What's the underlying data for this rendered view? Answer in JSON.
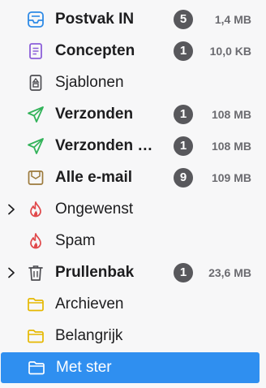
{
  "folders": [
    {
      "label": "Postvak IN",
      "badge": "5",
      "size": "1,4 MB",
      "icon": "inbox-icon"
    },
    {
      "label": "Concepten",
      "badge": "1",
      "size": "10,0 KB",
      "icon": "drafts-icon"
    },
    {
      "label": "Sjablonen",
      "icon": "templates-icon"
    },
    {
      "label": "Verzonden",
      "badge": "1",
      "size": "108 MB",
      "icon": "sent-icon"
    },
    {
      "label": "Verzonden …",
      "badge": "1",
      "size": "108 MB",
      "icon": "sent-icon"
    },
    {
      "label": "Alle e-mail",
      "badge": "9",
      "size": "109 MB",
      "icon": "archive-box-icon"
    },
    {
      "label": "Ongewenst",
      "icon": "junk-flame-icon",
      "twisty": "chevron-right-icon"
    },
    {
      "label": "Spam",
      "icon": "junk-flame-icon"
    },
    {
      "label": "Prullenbak",
      "badge": "1",
      "size": "23,6 MB",
      "icon": "trash-icon",
      "twisty": "chevron-right-icon"
    },
    {
      "label": "Archieven",
      "icon": "folder-icon"
    },
    {
      "label": "Belangrijk",
      "icon": "folder-icon"
    },
    {
      "label": "Met ster",
      "icon": "folder-icon",
      "selected": true
    }
  ],
  "colors": {
    "selection": "#2f8ff0",
    "badge": "#58585c",
    "inbox_accent": "#2e8ae6",
    "drafts_accent": "#8c5fd9",
    "sent_accent": "#33b35a",
    "junk_accent": "#e0484a",
    "folder_accent": "#e6b800"
  }
}
